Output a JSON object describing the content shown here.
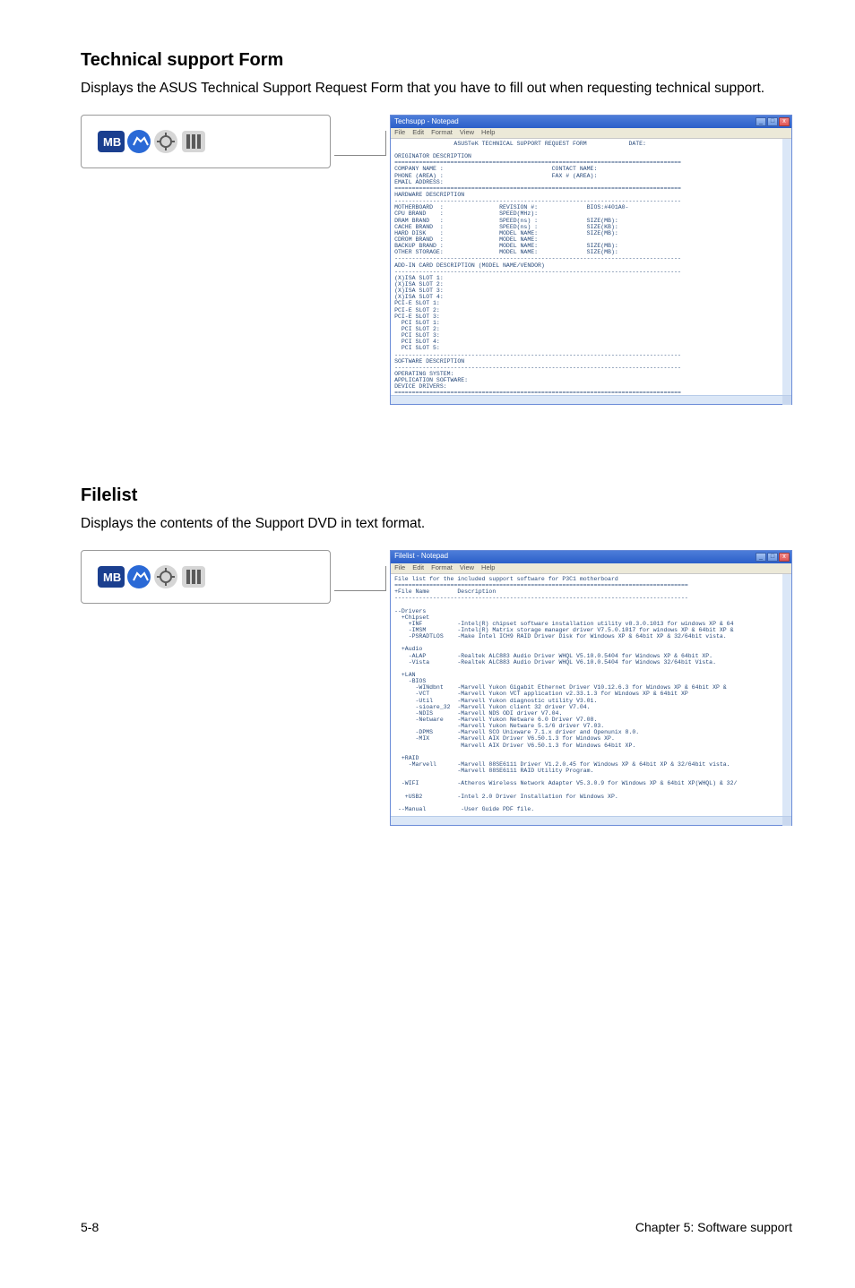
{
  "sections": {
    "technical": {
      "title": "Technical support Form",
      "blurb": "Displays the ASUS Technical Support Request Form that you have to fill out when requesting technical support."
    },
    "filelist": {
      "title": "Filelist",
      "blurb": "Displays the contents of the Support DVD in text format."
    }
  },
  "notepad1": {
    "title": "Techsupp - Notepad",
    "menus": [
      "File",
      "Edit",
      "Format",
      "View",
      "Help"
    ],
    "body": "                 ASUSTeK TECHNICAL SUPPORT REQUEST FORM            DATE:\n\nORIGINATOR DESCRIPTION\n==================================================================================\nCOMPANY NAME :                               CONTACT NAME:\nPHONE (AREA) :                               FAX # (AREA):\nEMAIL ADDRESS:\n==================================================================================\nHARDWARE DESCRIPTION\n----------------------------------------------------------------------------------\nMOTHERBOARD  :                REVISION #:              BIOS:#401A0-\nCPU BRAND    :                SPEED(MHz):\nDRAM BRAND   :                SPEED(ns) :              SIZE(MB):\nCACHE BRAND  :                SPEED(ns) :              SIZE(KB):\nHARD DISK    :                MODEL NAME:              SIZE(MB):\nCDROM BRAND  :                MODEL NAME:\nBACKUP BRAND :                MODEL NAME:              SIZE(MB):\nOTHER STORAGE:                MODEL NAME:              SIZE(MB):\n----------------------------------------------------------------------------------\nADD-IN CARD DESCRIPTION (MODEL NAME/VENDOR)\n----------------------------------------------------------------------------------\n(X)ISA SLOT 1:\n(X)ISA SLOT 2:\n(X)ISA SLOT 3:\n(X)ISA SLOT 4:\nPCI-E SLOT 1:\nPCI-E SLOT 2:\nPCI-E SLOT 3:\n  PCI SLOT 1:\n  PCI SLOT 2:\n  PCI SLOT 3:\n  PCI SLOT 4:\n  PCI SLOT 5:\n----------------------------------------------------------------------------------\nSOFTWARE DESCRIPTION\n----------------------------------------------------------------------------------\nOPERATING SYSTEM:\nAPPLICATION SOFTWARE:\nDEVICE DRIVERS:\n==================================================================================\nPROBLEM DESCRIPTION (WHAT PROBLEMS AND UNDER WHAT SITUATIONS)\n----------------------------------------------------------------------------------"
  },
  "notepad2": {
    "title": "Filelist - Notepad",
    "menus": [
      "File",
      "Edit",
      "Format",
      "View",
      "Help"
    ],
    "body": "File list for the included support software for P3C1 motherboard\n====================================================================================\n+File Name        Description\n------------------------------------------------------------------------------------\n\n--Drivers\n  +Chipset\n    +INF          -Intel(R) chipset software installation utility v8.3.0.1013 for windows XP & 64\n    -IMSM         -Intel(R) Matrix storage manager driver V7.5.0.1017 for windows XP & 64bit XP &\n    -PSRADTLOS    -Make Intel ICH9 RAID Driver Disk for Windows XP & 64bit XP & 32/64bit vista.\n\n  +Audio\n    -ALAP         -Realtek ALC883 Audio Driver WHQL V5.10.0.5404 for Windows XP & 64bit XP.\n    -Vista        -Realtek ALC883 Audio Driver WHQL V6.10.0.5404 for Windows 32/64bit Vista.\n\n  +LAN\n    -BIOS\n      -WINdbnt    -Marvell Yukon Gigabit Ethernet Driver V10.12.6.3 for Windows XP & 64bit XP &\n      -VCT        -Marvell Yukon VCT application v2.33.1.3 for Windows XP & 64bit XP\n      -Util       -Marvell Yukon diagnostic utility V3.01.\n      -sioare_32  -Marvell Yukon client 32 driver V7.04.\n      -NDIS       -Marvell NDS ODI driver V7.04.\n      -Netware    -Marvell Yukon Netware 6.0 Driver V7.08.\n                  -Marvell Yukon Netware 5.1/6 driver V7.03.\n      -DPMS       -Marvell SCO Unixware 7.1.x driver and Openunix 8.0.\n      -MIX        -Marvell AIX Driver V6.50.1.3 for Windows XP.\n                   Marvell AIX Driver V6.50.1.3 for Windows 64bit XP.\n\n  +RAID\n    -Marvell      -Marvell 88SE6111 Driver V1.2.0.45 for Windows XP & 64bit XP & 32/64bit vista.\n                  -Marvell 88SE6111 RAID Utility Program.\n\n  -WIFI           -Atheros Wireless Network Adapter V5.3.0.9 for Windows XP & 64bit XP(WHQL) & 32/\n\n   +USB2          -Intel 2.0 Driver Installation for Windows XP.\n\n --Manual          -User Guide PDF file."
  },
  "footer": {
    "left": "5-8",
    "right": "Chapter 5: Software support"
  },
  "win_buttons": {
    "min": "_",
    "max": "□",
    "close": "x"
  }
}
